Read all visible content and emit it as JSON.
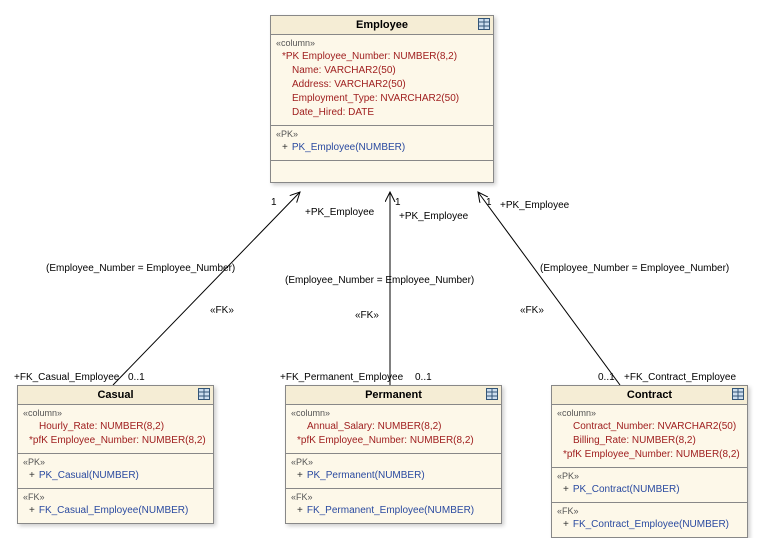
{
  "entities": {
    "employee": {
      "title": "Employee",
      "stereotype_col": "«column»",
      "columns": [
        {
          "text": "*PK Employee_Number: NUMBER(8,2)",
          "pk": true,
          "indent": 0
        },
        {
          "text": "Name: VARCHAR2(50)",
          "pk": false,
          "indent": 1
        },
        {
          "text": "Address: VARCHAR2(50)",
          "pk": false,
          "indent": 1
        },
        {
          "text": "Employment_Type: NVARCHAR2(50)",
          "pk": false,
          "indent": 1
        },
        {
          "text": "Date_Hired: DATE",
          "pk": false,
          "indent": 1
        }
      ],
      "stereotype_pk": "«PK»",
      "pk_key": "PK_Employee(NUMBER)"
    },
    "casual": {
      "title": "Casual",
      "stereotype_col": "«column»",
      "columns": [
        {
          "text": "Hourly_Rate: NUMBER(8,2)",
          "pk": false,
          "indent": 1
        },
        {
          "text": "*pfK Employee_Number: NUMBER(8,2)",
          "pk": true,
          "indent": 0
        }
      ],
      "stereotype_pk": "«PK»",
      "pk_key": "PK_Casual(NUMBER)",
      "stereotype_fk": "«FK»",
      "fk_key": "FK_Casual_Employee(NUMBER)"
    },
    "permanent": {
      "title": "Permanent",
      "stereotype_col": "«column»",
      "columns": [
        {
          "text": "Annual_Salary: NUMBER(8,2)",
          "pk": false,
          "indent": 1
        },
        {
          "text": "*pfK Employee_Number: NUMBER(8,2)",
          "pk": true,
          "indent": 0
        }
      ],
      "stereotype_pk": "«PK»",
      "pk_key": "PK_Permanent(NUMBER)",
      "stereotype_fk": "«FK»",
      "fk_key": "FK_Permanent_Employee(NUMBER)"
    },
    "contract": {
      "title": "Contract",
      "stereotype_col": "«column»",
      "columns": [
        {
          "text": "Contract_Number: NVARCHAR2(50)",
          "pk": false,
          "indent": 1
        },
        {
          "text": "Billing_Rate: NUMBER(8,2)",
          "pk": false,
          "indent": 1
        },
        {
          "text": "*pfK Employee_Number: NUMBER(8,2)",
          "pk": true,
          "indent": 0
        }
      ],
      "stereotype_pk": "«PK»",
      "pk_key": "PK_Contract(NUMBER)",
      "stereotype_fk": "«FK»",
      "fk_key": "FK_Contract_Employee(NUMBER)"
    }
  },
  "labels": {
    "pk_emp_left": "+PK_Employee",
    "pk_emp_mid": "+PK_Employee",
    "pk_emp_right": "+PK_Employee",
    "mult_1_left": "1",
    "mult_1_mid": "1",
    "mult_1_right": "1",
    "join_left": "(Employee_Number = Employee_Number)",
    "join_mid": "(Employee_Number = Employee_Number)",
    "join_right": "(Employee_Number = Employee_Number)",
    "fk_stereo_left": "«FK»",
    "fk_stereo_mid": "«FK»",
    "fk_stereo_right": "«FK»",
    "fk_casual": "+FK_Casual_Employee",
    "fk_permanent": "+FK_Permanent_Employee",
    "fk_contract": "+FK_Contract_Employee",
    "mult_01_left": "0..1",
    "mult_01_mid": "0..1",
    "mult_01_right": "0..1"
  }
}
